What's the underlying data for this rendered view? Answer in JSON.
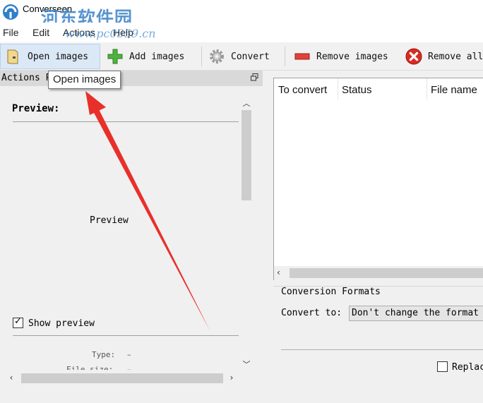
{
  "window": {
    "title": "Converseen",
    "watermark_logo": "河东软件园",
    "watermark_url": "www.pc0359.cn"
  },
  "menu": {
    "file": "File",
    "edit": "Edit",
    "actions": "Actions",
    "help": "Help"
  },
  "toolbar": {
    "open_images": "Open images",
    "add_images": "Add images",
    "convert": "Convert",
    "remove_images": "Remove images",
    "remove_all": "Remove all"
  },
  "actions_panel": {
    "title": "Actions P",
    "tooltip": "Open images",
    "preview_heading": "Preview:",
    "preview_placeholder": "Preview",
    "show_preview_label": "Show preview",
    "show_preview_checked": true,
    "type_label": "Type:",
    "type_value": "–",
    "file_size_label": "File size:",
    "file_size_value": "–"
  },
  "file_table": {
    "columns": [
      "To convert",
      "Status",
      "File name"
    ]
  },
  "conversion_formats": {
    "title": "Conversion Formats",
    "convert_to_label": "Convert to:",
    "selected_format": "Don't change the format",
    "replace_label": "Replac",
    "replace_checked": false
  },
  "colors": {
    "toolbar_bg": "#f1f1f1",
    "active_button_bg": "#dbe8f6",
    "annotation_arrow": "#e8302a"
  }
}
